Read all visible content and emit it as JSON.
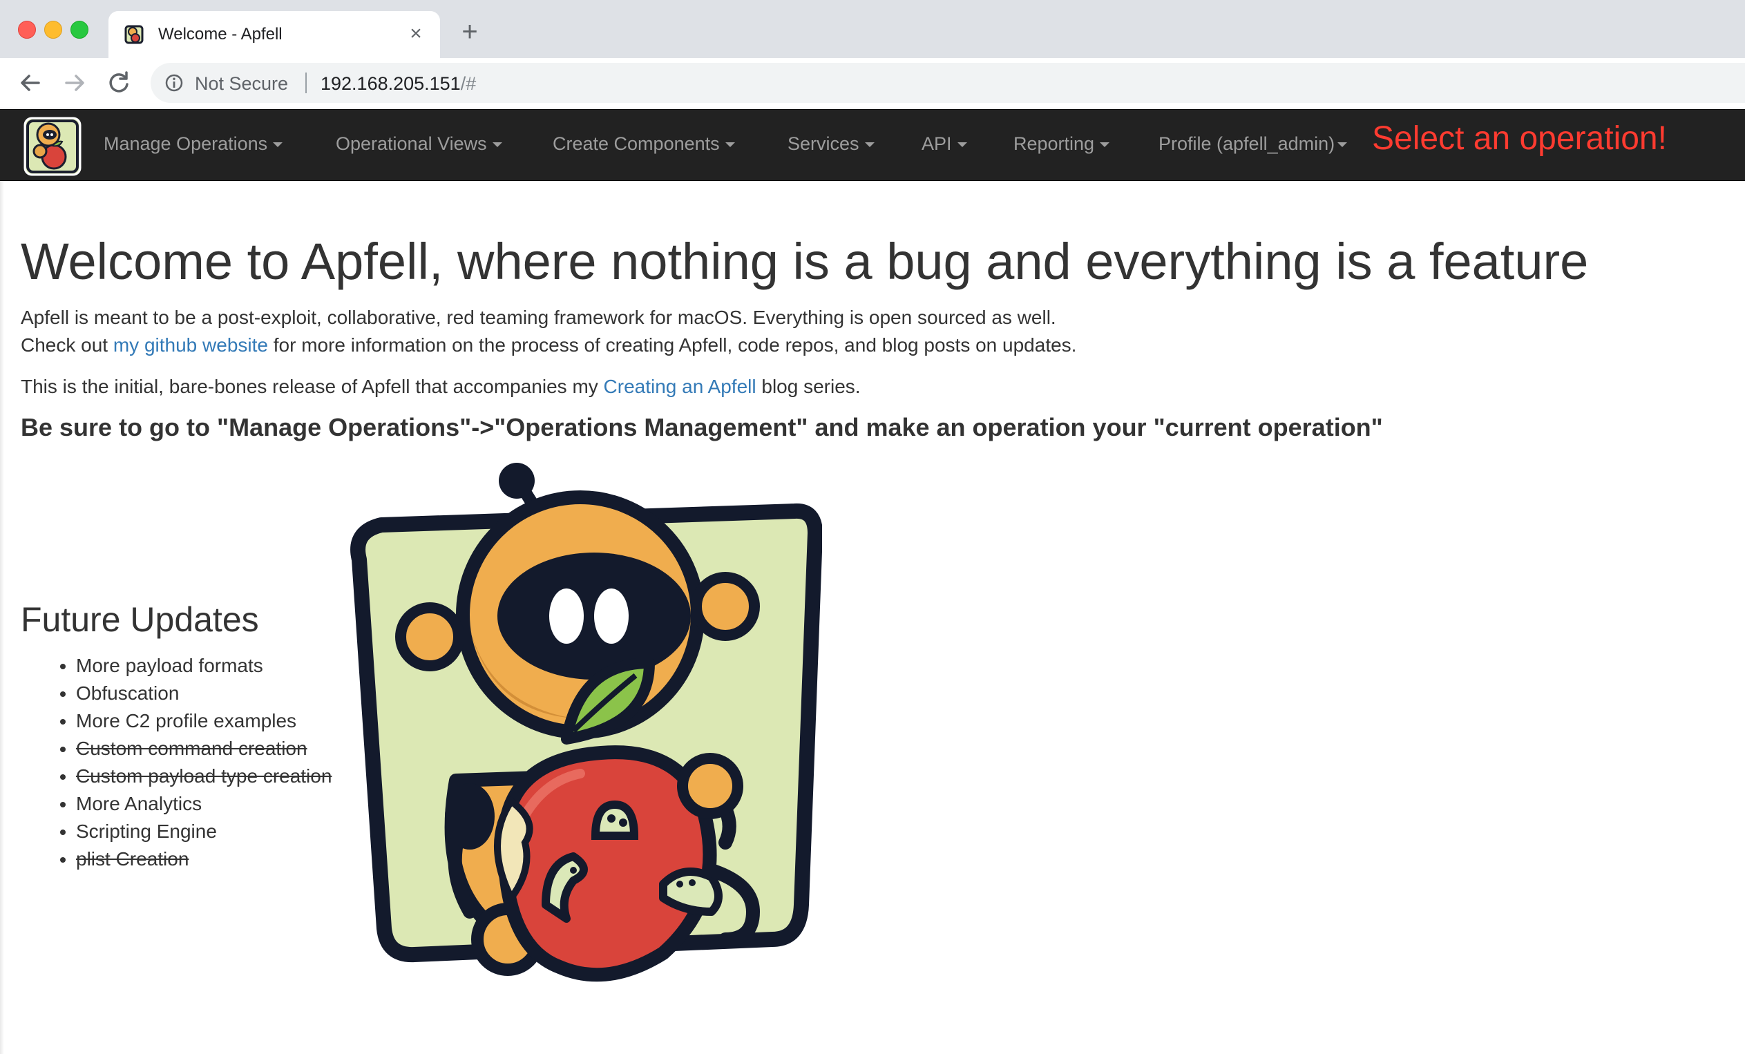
{
  "browser": {
    "tab_title": "Welcome - Apfell",
    "tab_close": "×",
    "new_tab": "+",
    "security_label": "Not Secure",
    "url_host": "192.168.205.151",
    "url_path": "/#"
  },
  "navbar": {
    "items": [
      {
        "label": "Manage Operations"
      },
      {
        "label": "Operational Views"
      },
      {
        "label": "Create Components"
      },
      {
        "label": "Services"
      },
      {
        "label": "API"
      },
      {
        "label": "Reporting"
      },
      {
        "label": "Profile (apfell_admin)"
      }
    ],
    "operation_notice": "Select an operation!",
    "notice_color": "#ff3b30"
  },
  "main": {
    "title": "Welcome to Apfell, where nothing is a bug and everything is a feature",
    "intro": "Apfell is meant to be a post-exploit, collaborative, red teaming framework for macOS. Everything is open sourced as well.",
    "checkout_prefix": "Check out ",
    "checkout_link": "my github website",
    "checkout_suffix": " for more information on the process of creating Apfell, code repos, and blog posts on updates.",
    "release_prefix": "This is the initial, bare-bones release of Apfell that accompanies my ",
    "release_link": "Creating an Apfell",
    "release_suffix": " blog series.",
    "ops_hint": "Be sure to go to \"Manage Operations\"->\"Operations Management\" and make an operation your \"current operation\"",
    "link_color": "#337ab7"
  },
  "future_updates": {
    "title": "Future Updates",
    "items": [
      {
        "label": "More payload formats",
        "done": false
      },
      {
        "label": "Obfuscation",
        "done": false
      },
      {
        "label": "More C2 profile examples",
        "done": false
      },
      {
        "label": "Custom command creation",
        "done": true
      },
      {
        "label": "Custom payload type creation",
        "done": true
      },
      {
        "label": "More Analytics",
        "done": false
      },
      {
        "label": "Scripting Engine",
        "done": false
      },
      {
        "label": "plist Creation",
        "done": true
      }
    ]
  }
}
